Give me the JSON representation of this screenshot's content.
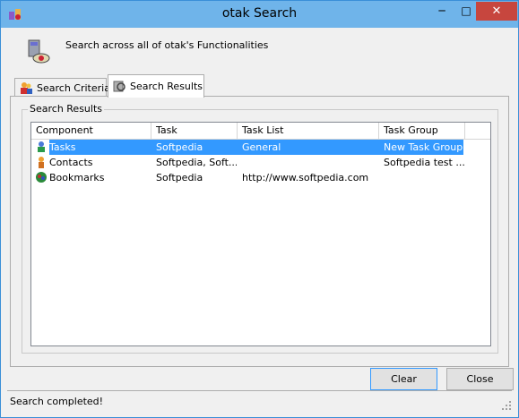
{
  "window": {
    "title": "otak Search",
    "minimize": "─",
    "maximize": "□",
    "close": "✕"
  },
  "header": {
    "description": "Search across all of otak's Functionalities"
  },
  "tabs": [
    {
      "label": "Search Criteria"
    },
    {
      "label": "Search Results"
    }
  ],
  "results": {
    "group_label": "Search Results",
    "columns": [
      "Component",
      "Task",
      "Task List",
      "Task Group"
    ],
    "rows": [
      {
        "component": "Tasks",
        "task": "Softpedia",
        "task_list": "General",
        "task_group": "New Task Group",
        "icon": "tasks-icon",
        "selected": true
      },
      {
        "component": "Contacts",
        "task": "Softpedia, Soft...",
        "task_list": "",
        "task_group": "Softpedia test ...",
        "icon": "contacts-icon",
        "selected": false
      },
      {
        "component": "Bookmarks",
        "task": "Softpedia",
        "task_list": "http://www.softpedia.com",
        "task_group": "",
        "icon": "bookmarks-icon",
        "selected": false
      }
    ]
  },
  "buttons": {
    "clear": "Clear",
    "close": "Close"
  },
  "status": {
    "text": "Search completed!"
  },
  "colors": {
    "titlebar": "#6fb4ea",
    "selection": "#3399ff",
    "close": "#c7463e"
  }
}
